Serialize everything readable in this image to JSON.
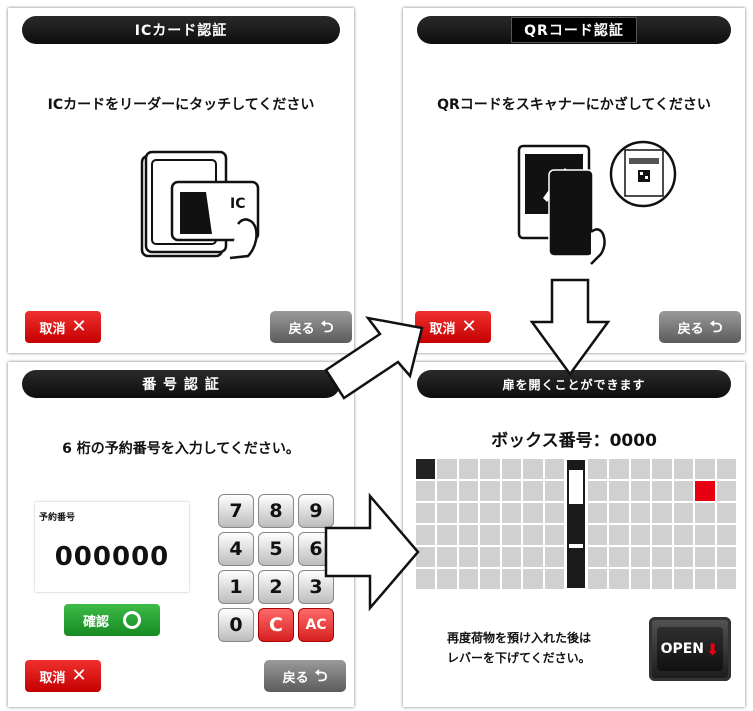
{
  "ic_panel": {
    "title": "ICカード認証",
    "instruction": "ICカードをリーダーにタッチしてください",
    "card_label": "IC",
    "cancel_label": "取消",
    "back_label": "戻る"
  },
  "qr_panel": {
    "title": "QRコード認証",
    "instruction": "QRコードをスキャナーにかざしてください",
    "cancel_label": "取消",
    "back_label": "戻る"
  },
  "pin_panel": {
    "title": "番 号 認 証",
    "instruction": "6 桁の予約番号を入力してください。",
    "field_label": "予約番号",
    "field_value": "000000",
    "confirm_label": "確認",
    "keys": [
      {
        "label": "7",
        "style": "normal"
      },
      {
        "label": "8",
        "style": "normal"
      },
      {
        "label": "9",
        "style": "normal"
      },
      {
        "label": "4",
        "style": "normal"
      },
      {
        "label": "5",
        "style": "normal"
      },
      {
        "label": "6",
        "style": "normal"
      },
      {
        "label": "1",
        "style": "normal"
      },
      {
        "label": "2",
        "style": "normal"
      },
      {
        "label": "3",
        "style": "normal"
      },
      {
        "label": "0",
        "style": "normal"
      },
      {
        "label": "C",
        "style": "red"
      },
      {
        "label": "AC",
        "style": "red"
      }
    ],
    "cancel_label": "取消",
    "back_label": "戻る"
  },
  "box_panel": {
    "title": "扉を開くことができます",
    "box_number": "ボックス番号：0000",
    "message_line1": "再度荷物を預け入れた後は",
    "message_line2": "レバーを下げてください。",
    "open_label": "OPEN"
  },
  "colors": {
    "header_bg": "#111111",
    "cancel_red": "#d40000",
    "confirm_green": "#22a12e",
    "highlight_red": "#e60012",
    "cell_gray": "#d0d0d0",
    "occupied_black": "#222222"
  }
}
